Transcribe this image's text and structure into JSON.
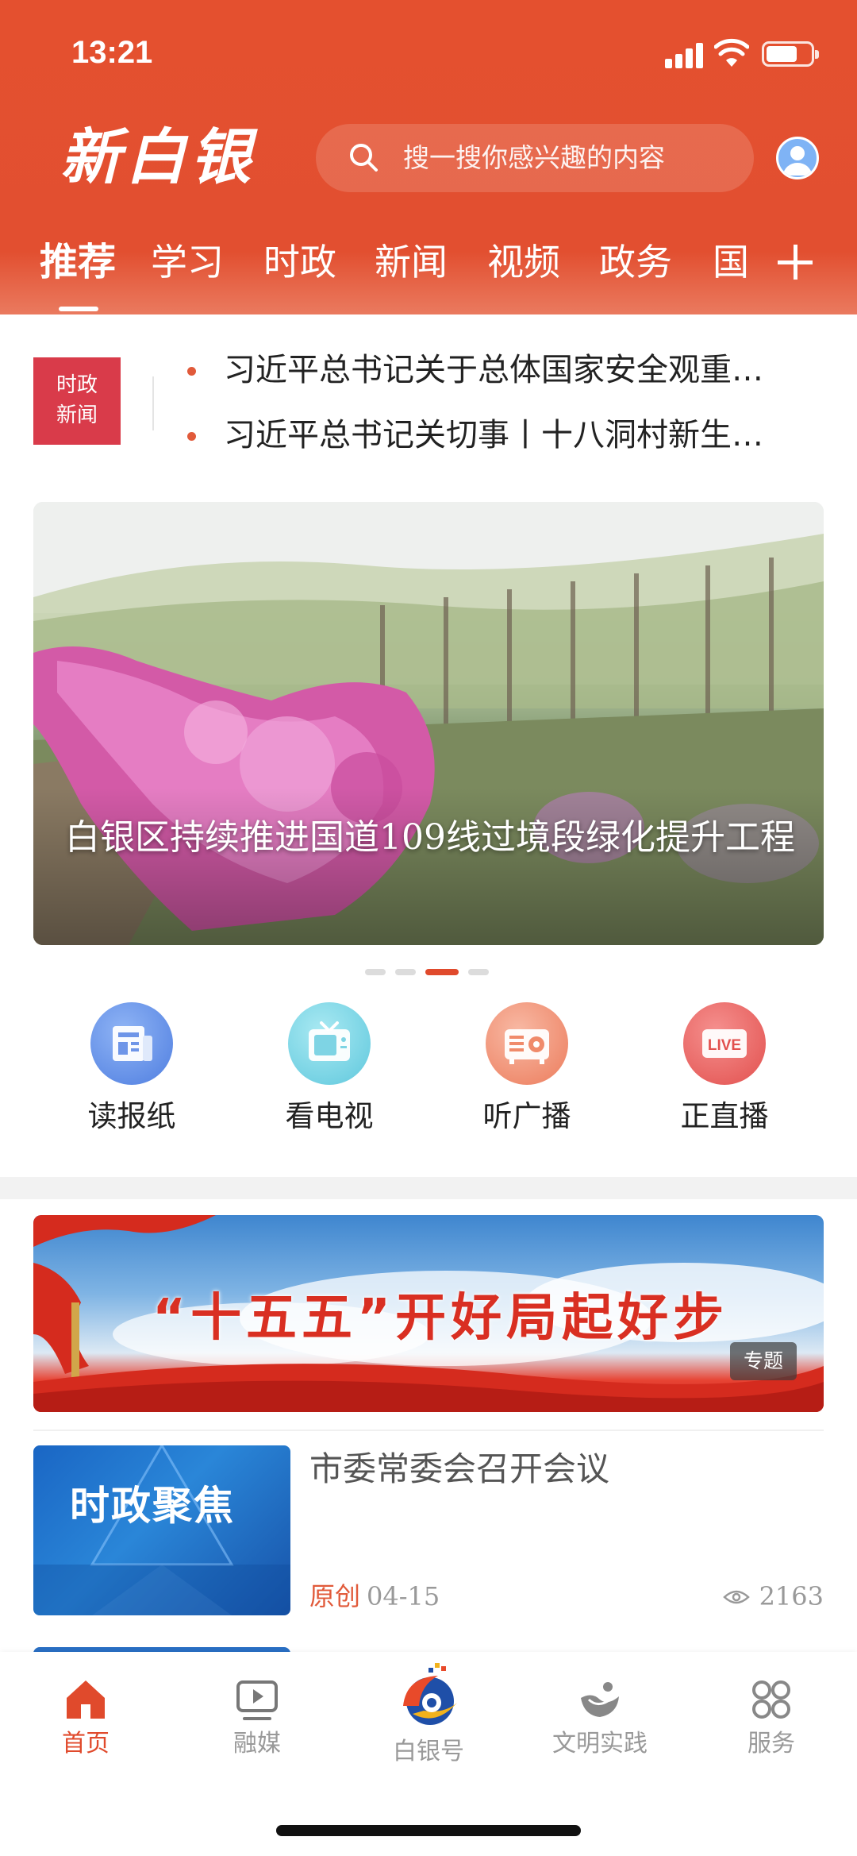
{
  "status_bar": {
    "time": "13:21",
    "battery_level": 0.7
  },
  "header": {
    "logo_text": "新白银",
    "search_placeholder": "搜一搜你感兴趣的内容",
    "tabs": [
      "推荐",
      "学习",
      "时政",
      "新闻",
      "视频",
      "政务",
      "国"
    ],
    "active_tab": "推荐"
  },
  "ticker": {
    "badge_line1": "时政",
    "badge_line2": "新闻",
    "items": [
      "习近平总书记关于总体国家安全观重…",
      "习近平总书记关切事丨十八洞村新生…"
    ]
  },
  "banner": {
    "caption": "白银区持续推进国道109线过境段绿化提升工程",
    "slide_count": 4,
    "active_slide": 3
  },
  "quick_links": [
    {
      "label": "读报纸",
      "icon": "newspaper-icon",
      "color": "#5b8fe8"
    },
    {
      "label": "看电视",
      "icon": "tv-icon",
      "color": "#6fd2e4"
    },
    {
      "label": "听广播",
      "icon": "radio-icon",
      "color": "#f29173"
    },
    {
      "label": "正直播",
      "icon": "live-icon",
      "color": "#e85a58"
    }
  ],
  "topic": {
    "title": "“十五五”开好局起好步",
    "tag": "专题"
  },
  "article": {
    "thumb_text": "时政聚焦",
    "title": "市委常委会召开会议",
    "source": "原创",
    "date": "04-15",
    "views": "2163"
  },
  "bottom_nav": [
    {
      "label": "首页",
      "icon": "home-icon",
      "active": true
    },
    {
      "label": "融媒",
      "icon": "media-play-icon",
      "active": false
    },
    {
      "label": "白银号",
      "icon": "baiyin-logo-icon",
      "active": false
    },
    {
      "label": "文明实践",
      "icon": "civilization-icon",
      "active": false
    },
    {
      "label": "服务",
      "icon": "services-grid-icon",
      "active": false
    }
  ],
  "colors": {
    "brand": "#e4502f",
    "accent_red": "#d93b4a",
    "muted": "#999999"
  }
}
